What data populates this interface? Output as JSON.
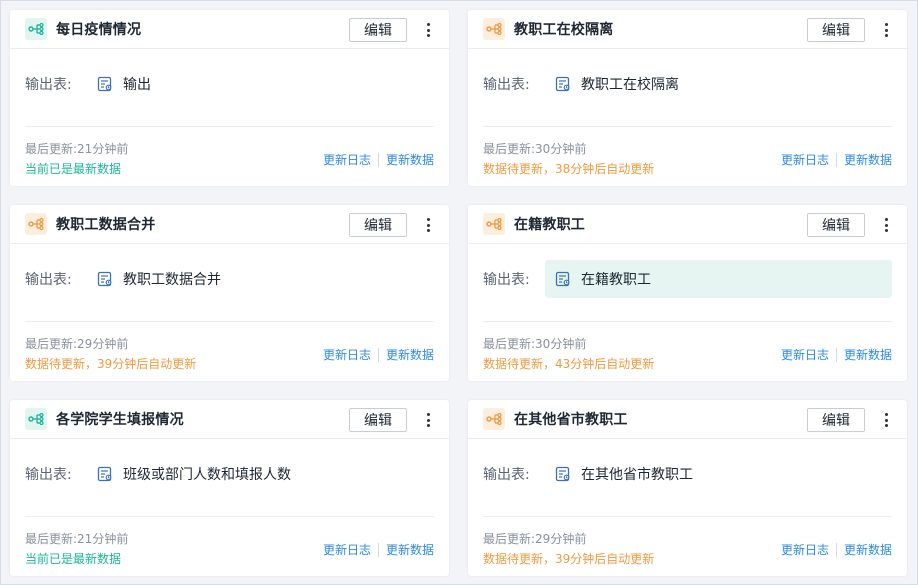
{
  "labels": {
    "edit": "编辑",
    "output_label": "输出表:",
    "log_link": "更新日志",
    "update_link": "更新数据"
  },
  "colors": {
    "teal_icon": "#19b39a",
    "orange_icon": "#f2973d",
    "status_ok": "#1cb69a",
    "status_pending": "#f29a3f",
    "link": "#2c8be6"
  },
  "cards": [
    {
      "title": "每日疫情情况",
      "icon": "flow-teal-icon",
      "output": "输出",
      "updated": "最后更新:21分钟前",
      "status": "当前已是最新数据",
      "status_type": "ok",
      "highlighted": false
    },
    {
      "title": "教职工在校隔离",
      "icon": "flow-orange-icon",
      "output": "教职工在校隔离",
      "updated": "最后更新:30分钟前",
      "status": "数据待更新，38分钟后自动更新",
      "status_type": "pending",
      "highlighted": false
    },
    {
      "title": "教职工数据合并",
      "icon": "flow-orange-icon",
      "output": "教职工数据合并",
      "updated": "最后更新:29分钟前",
      "status": "数据待更新，39分钟后自动更新",
      "status_type": "pending",
      "highlighted": false
    },
    {
      "title": "在籍教职工",
      "icon": "flow-orange-icon",
      "output": "在籍教职工",
      "updated": "最后更新:30分钟前",
      "status": "数据待更新，43分钟后自动更新",
      "status_type": "pending",
      "highlighted": true
    },
    {
      "title": "各学院学生填报情况",
      "icon": "flow-teal-icon",
      "output": "班级或部门人数和填报人数",
      "updated": "最后更新:21分钟前",
      "status": "当前已是最新数据",
      "status_type": "ok",
      "highlighted": false
    },
    {
      "title": "在其他省市教职工",
      "icon": "flow-orange-icon",
      "output": "在其他省市教职工",
      "updated": "最后更新:29分钟前",
      "status": "数据待更新，39分钟后自动更新",
      "status_type": "pending",
      "highlighted": false
    }
  ]
}
